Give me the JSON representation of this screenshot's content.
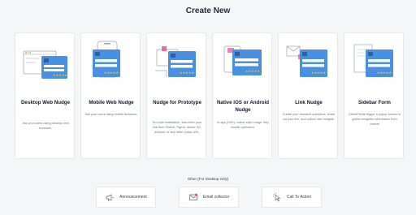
{
  "page": {
    "title": "Create New"
  },
  "cards": [
    {
      "title": "Desktop Web Nudge",
      "desc": "Ask your users using desktop web browsers."
    },
    {
      "title": "Mobile Web Nudge",
      "desc": "Ask your users using mobile browsers."
    },
    {
      "title": "Nudge for Prototype",
      "desc": "No-code installation. Just enter your link from Sketch, Figma, Adobe XD, InVision, or any other public URL."
    },
    {
      "title": "Native iOS or Android Nudge",
      "desc": "In-app (SDK), native-style nudge, fully mobile optimized."
    },
    {
      "title": "Link Nudge",
      "desc": "Create your research questions, share via your link, and collect user insights."
    },
    {
      "title": "Sidebar Form",
      "desc": "ClickeFeeds trigger a popup screen to gather insightful information from visitors"
    }
  ],
  "other": {
    "label": "Other (For Desktop Only)",
    "buttons": [
      {
        "label": "Announcement",
        "icon": "megaphone-icon"
      },
      {
        "label": "Email collector",
        "icon": "envelope-icon"
      },
      {
        "label": "Call To Action",
        "icon": "cursor-click-icon"
      }
    ]
  },
  "colors": {
    "accent": "#4a90e2",
    "star": "#f5c518",
    "pink": "#ec4899"
  }
}
